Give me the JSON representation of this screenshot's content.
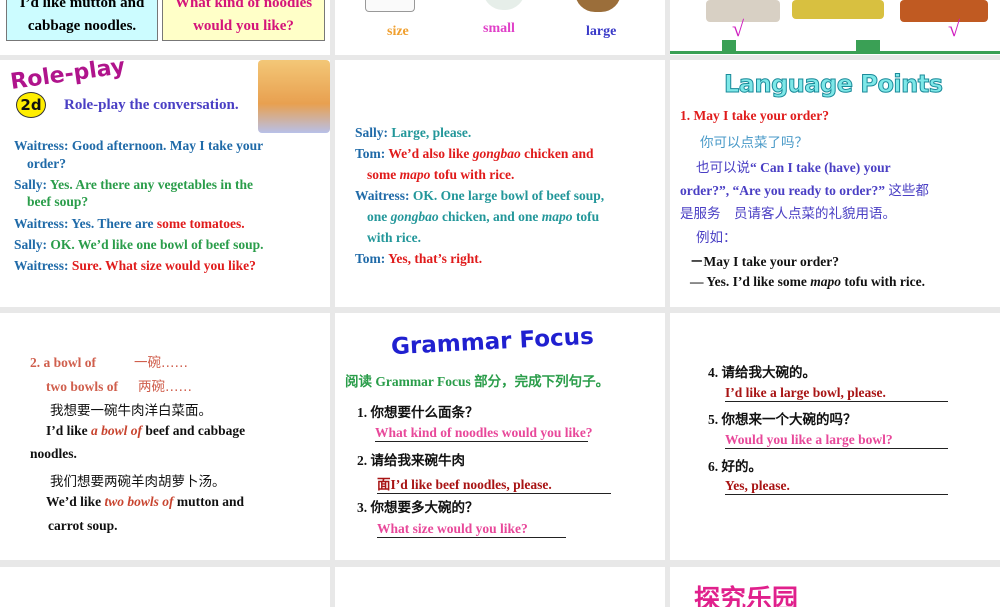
{
  "row1": {
    "box_cyan": [
      "I’d like mutton and",
      "cabbage noodles."
    ],
    "box_yellow": [
      "What kind of noodles",
      "would you like?"
    ],
    "size_labels": [
      "size",
      "small",
      "large"
    ],
    "check": "√"
  },
  "roleplay": {
    "banner": "Role-play",
    "badge": "2d",
    "title": "Role-play the conversation.",
    "lines": [
      [
        "Waitress: ",
        "Good afternoon. May I take your"
      ],
      [
        "order?"
      ],
      [
        "Sally: ",
        "Yes. Are there any vegetables in the"
      ],
      [
        "beef soup?"
      ],
      [
        "Waitress: ",
        "Yes. There are ",
        "some tomatoes."
      ],
      [
        "Sally: ",
        "OK. We’d like one bowl of beef soup."
      ],
      [
        "Waitress: ",
        "Sure. What size would you  like?"
      ]
    ]
  },
  "dialogue2": {
    "lines": [
      [
        "Sally: ",
        "Large, please."
      ],
      [
        "Tom: ",
        "We’d also like ",
        "gongbao",
        " chicken and"
      ],
      [
        "some ",
        "mapo",
        " tofu with rice."
      ],
      [
        "Waitress: ",
        "OK. One large bowl of beef soup,"
      ],
      [
        "one ",
        "gongbao",
        " chicken, and one ",
        "mapo",
        " tofu"
      ],
      [
        "with rice."
      ],
      [
        "Tom: ",
        "Yes, that’s right."
      ]
    ]
  },
  "language_points": {
    "title": "Language Points",
    "l1": "1. May I take your order?",
    "l2": "你可以点菜了吗？",
    "l3": [
      "也可以说",
      "“ Can I take (have) your"
    ],
    "l4": [
      "order?”, “Are you ready to order?”",
      "这些都"
    ],
    "l5": "是服务　员请客人点菜的礼貌用语。",
    "l6": "例如：",
    "l7": "－May I take your order?",
    "l8": [
      "— Yes. I’d like some ",
      "mapo",
      " tofu with rice."
    ]
  },
  "bowl_of": {
    "l1": [
      "2.   a bowl of",
      "一碗……"
    ],
    "l2": [
      "two bowls of",
      "两碗……"
    ],
    "l3": "我想要一碗牛肉洋白菜面。",
    "l4": [
      "I’d like ",
      "a bowl of",
      " beef and cabbage"
    ],
    "l5": "noodles.",
    "l6": "我们想要两碗羊肉胡萝卜汤。",
    "l7": [
      "We’d like ",
      "two bowls of",
      " mutton and"
    ],
    "l8": "carrot soup."
  },
  "grammar": {
    "title": "Grammar Focus",
    "instruction": "阅读 Grammar Focus 部分，完成下列句子。",
    "items": [
      {
        "q": "1.  你想要什么面条？",
        "a": "What kind of noodles would you like?"
      },
      {
        "q": "2.  请给我来碗牛肉",
        "a": "面I’d like beef noodles, please."
      },
      {
        "q": "3.  你想要多大碗的？",
        "a": "What size would you like?"
      }
    ]
  },
  "grammar2": {
    "items": [
      {
        "q": "4.  请给我大碗的。",
        "a": "I’d like a large bowl, please."
      },
      {
        "q": "5.  你想来一个大碗的吗？",
        "a": "Would you like a large bowl?"
      },
      {
        "q": "6.  好的。",
        "a": "Yes, please."
      }
    ]
  },
  "explore": {
    "title": "探究乐园"
  }
}
